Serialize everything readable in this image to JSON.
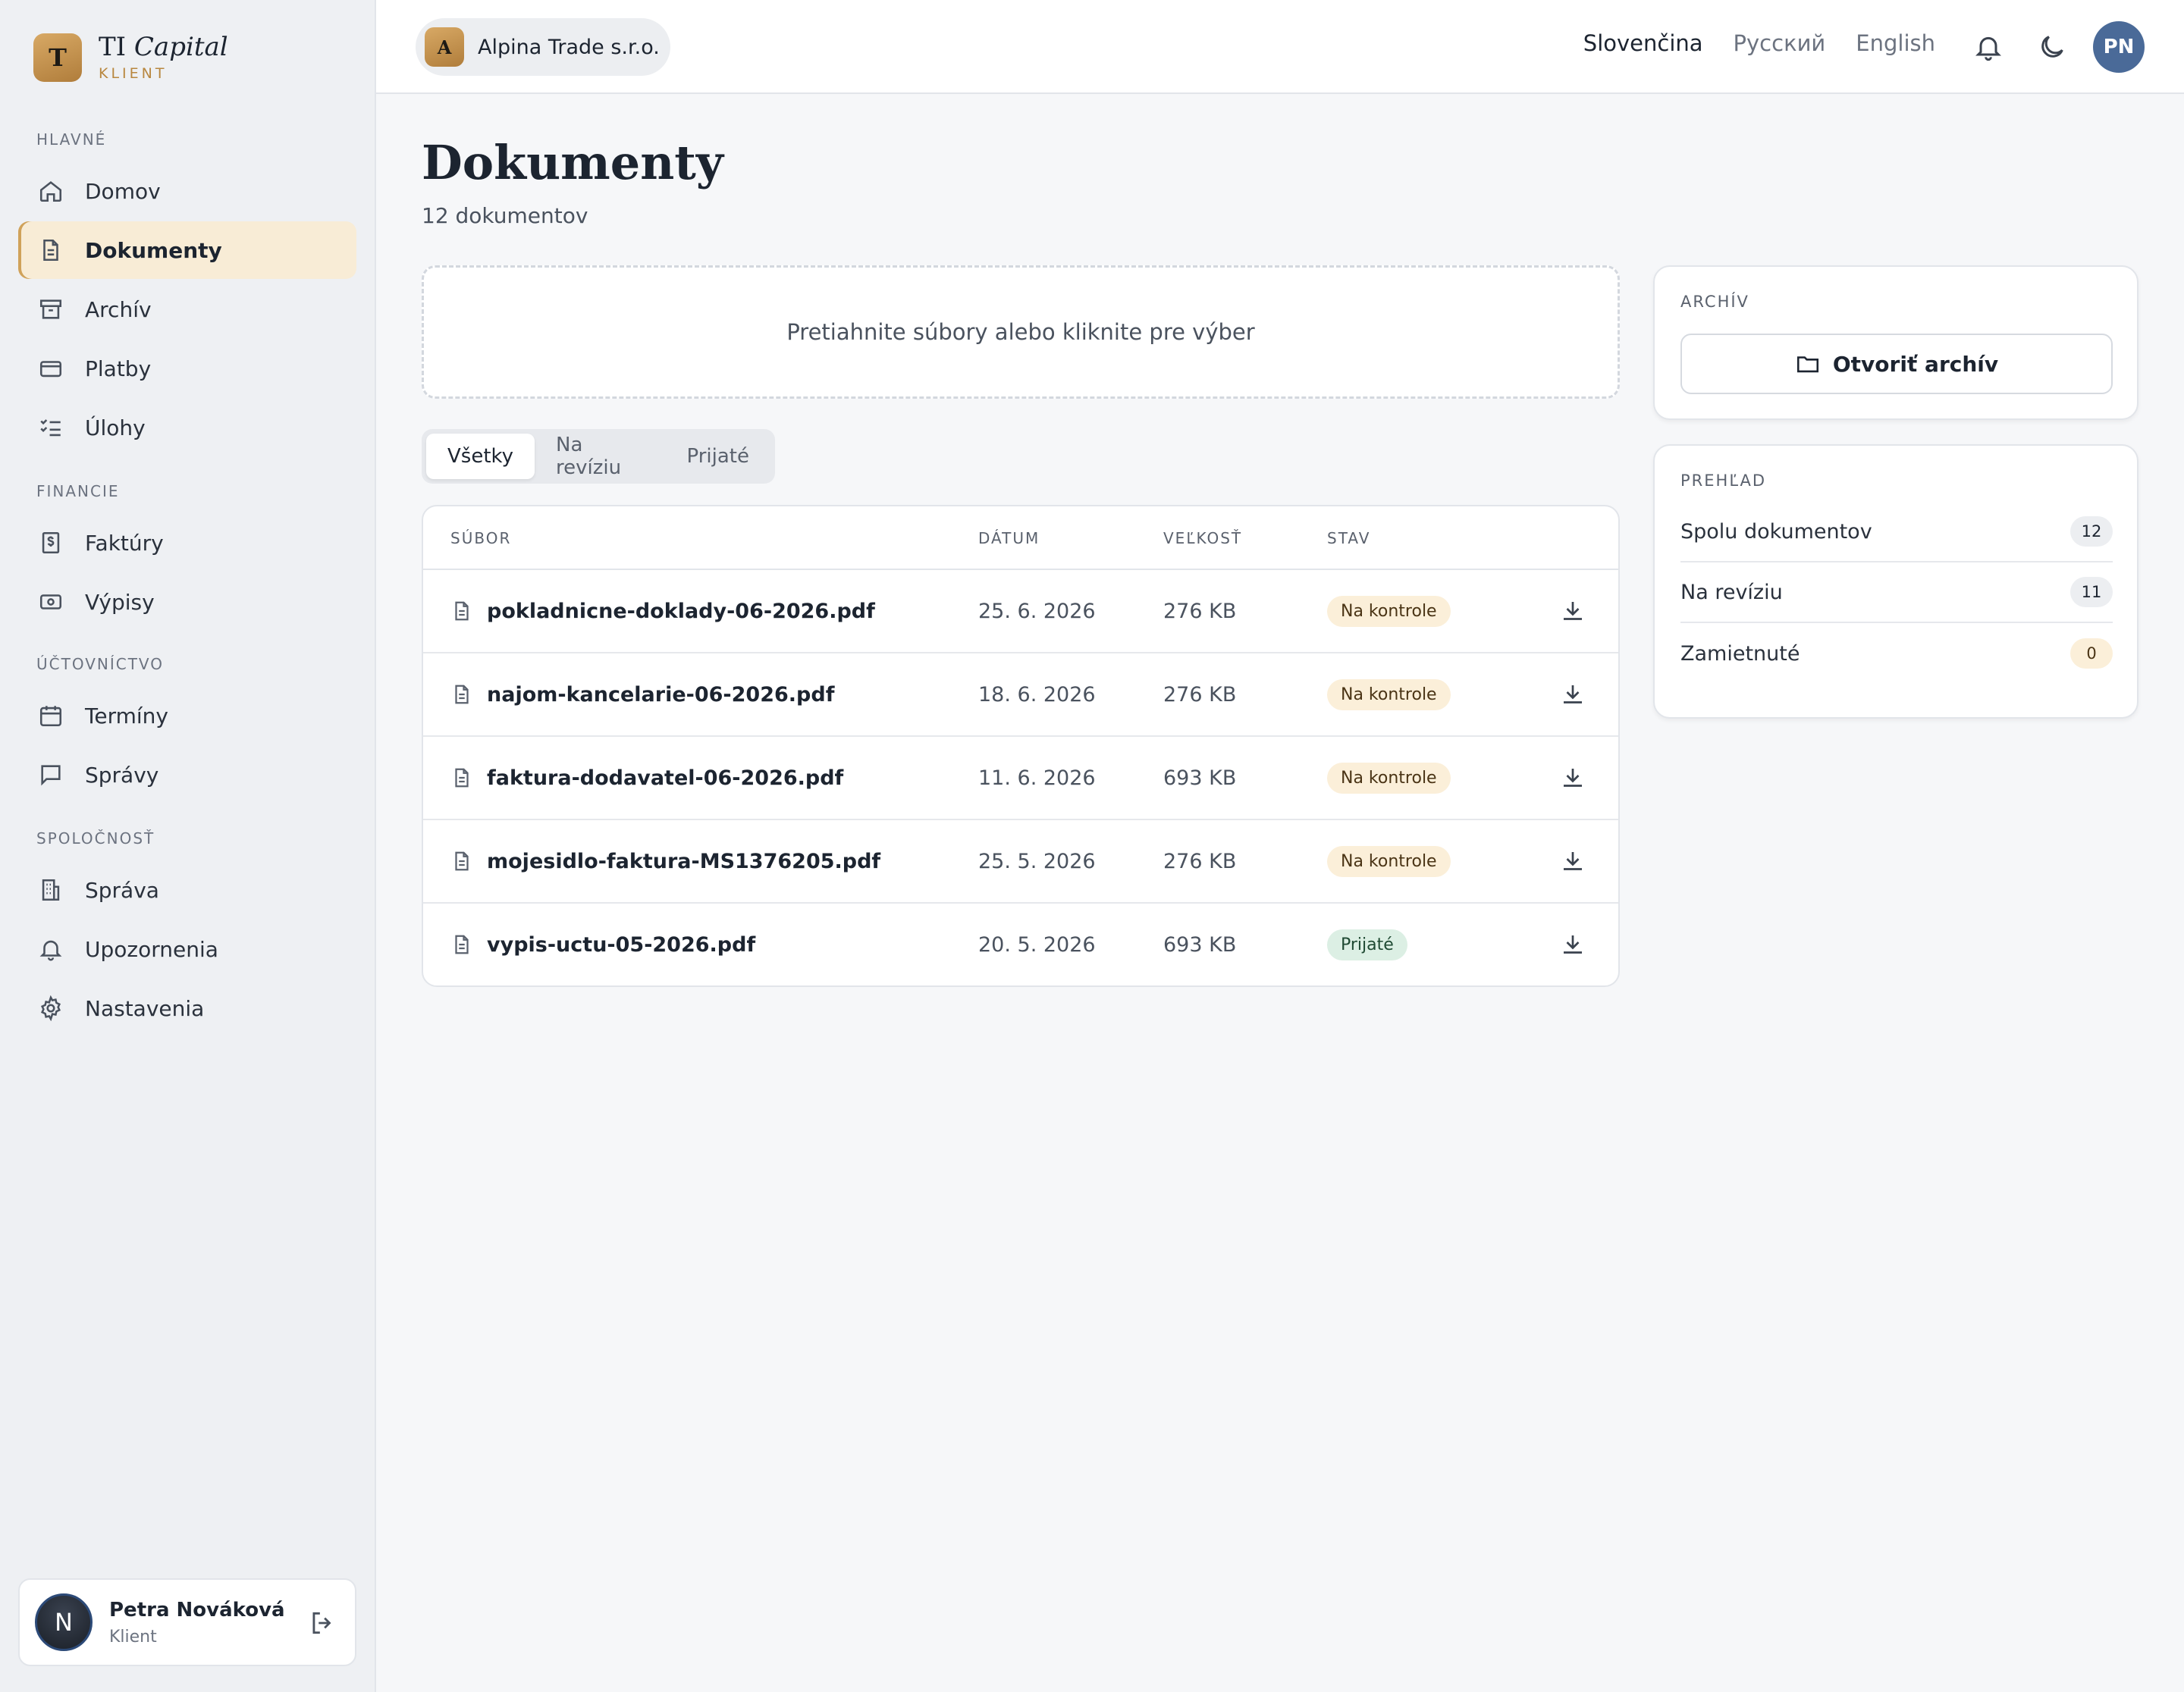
{
  "brand": {
    "logo_letter": "T",
    "name_plain": "TI",
    "name_italic": "Capital",
    "subtitle": "KLIENT",
    "accent_color": "#c99a55"
  },
  "sidebar": {
    "sections": [
      {
        "title": "HLAVNÉ",
        "items": [
          {
            "label": "Domov",
            "icon": "home-icon"
          },
          {
            "label": "Dokumenty",
            "icon": "document-icon",
            "active": true
          },
          {
            "label": "Archív",
            "icon": "archive-icon"
          },
          {
            "label": "Platby",
            "icon": "credit-card-icon"
          },
          {
            "label": "Úlohy",
            "icon": "checklist-icon"
          }
        ]
      },
      {
        "title": "FINANCIE",
        "items": [
          {
            "label": "Faktúry",
            "icon": "invoice-dollar-icon"
          },
          {
            "label": "Výpisy",
            "icon": "banknote-icon"
          }
        ]
      },
      {
        "title": "ÚČTOVNÍCTVO",
        "items": [
          {
            "label": "Termíny",
            "icon": "calendar-icon"
          },
          {
            "label": "Správy",
            "icon": "message-icon"
          }
        ]
      },
      {
        "title": "SPOLOČNOSŤ",
        "items": [
          {
            "label": "Správa",
            "icon": "building-icon"
          },
          {
            "label": "Upozornenia",
            "icon": "bell-icon"
          },
          {
            "label": "Nastavenia",
            "icon": "gear-icon"
          }
        ]
      }
    ],
    "user": {
      "initial": "N",
      "name": "Petra Nováková",
      "role": "Klient"
    }
  },
  "topbar": {
    "company": {
      "logo_letter": "A",
      "name": "Alpina Trade s.r.o."
    },
    "languages": [
      {
        "label": "Slovenčina",
        "active": true
      },
      {
        "label": "Русский",
        "active": false
      },
      {
        "label": "English",
        "active": false
      }
    ],
    "avatar_initials": "PN"
  },
  "main": {
    "title": "Dokumenty",
    "subtitle": "12 dokumentov",
    "dropzone_text": "Pretiahnite súbory alebo kliknite pre výber",
    "tabs": [
      {
        "label": "Všetky",
        "active": true
      },
      {
        "label": "Na revíziu",
        "active": false
      },
      {
        "label": "Prijaté",
        "active": false
      }
    ],
    "table": {
      "headers": {
        "file": "SÚBOR",
        "date": "DÁTUM",
        "size": "VEĽKOSŤ",
        "status": "STAV"
      },
      "rows": [
        {
          "file": "pokladnicne-doklady-06-2026.pdf",
          "date": "25. 6. 2026",
          "size": "276 KB",
          "status": "Na kontrole",
          "status_type": "pending"
        },
        {
          "file": "najom-kancelarie-06-2026.pdf",
          "date": "18. 6. 2026",
          "size": "276 KB",
          "status": "Na kontrole",
          "status_type": "pending"
        },
        {
          "file": "faktura-dodavatel-06-2026.pdf",
          "date": "11. 6. 2026",
          "size": "693 KB",
          "status": "Na kontrole",
          "status_type": "pending"
        },
        {
          "file": "mojesidlo-faktura-MS1376205.pdf",
          "date": "25. 5. 2026",
          "size": "276 KB",
          "status": "Na kontrole",
          "status_type": "pending"
        },
        {
          "file": "vypis-uctu-05-2026.pdf",
          "date": "20. 5. 2026",
          "size": "693 KB",
          "status": "Prijaté",
          "status_type": "accepted"
        }
      ]
    }
  },
  "archive_panel": {
    "title": "ARCHÍV",
    "button_label": "Otvoriť archív"
  },
  "overview_panel": {
    "title": "PREHĽAD",
    "stats": [
      {
        "label": "Spolu dokumentov",
        "value": "12",
        "tone": "neutral"
      },
      {
        "label": "Na revíziu",
        "value": "11",
        "tone": "neutral"
      },
      {
        "label": "Zamietnuté",
        "value": "0",
        "tone": "warn"
      }
    ]
  },
  "colors": {
    "pending_badge_bg": "#fbefd9",
    "accepted_badge_bg": "#dcefe4",
    "active_nav_bg": "#f8ecd6",
    "avatar_bg": "#4a6a98"
  }
}
